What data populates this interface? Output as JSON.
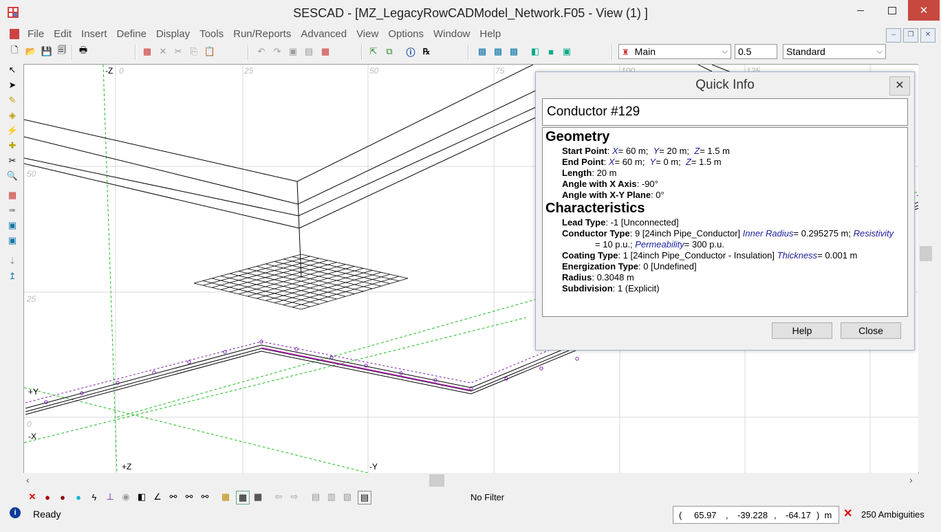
{
  "window": {
    "title": "SESCAD - [MZ_LegacyRowCADModel_Network.F05 - View (1) ]"
  },
  "menu": [
    "File",
    "Edit",
    "Insert",
    "Define",
    "Display",
    "Tools",
    "Run/Reports",
    "Advanced",
    "View",
    "Options",
    "Window",
    "Help"
  ],
  "toolbar": {
    "layer_value": "Main",
    "width_value": "0.5",
    "style_value": "Standard"
  },
  "canvas": {
    "axis_labels": {
      "neg_z_top": "-Z",
      "pos_y": "+Y",
      "neg_x": "-X",
      "pos_z": "+Z",
      "neg_y": "-Y"
    },
    "grid_labels": {
      "top_0": "0",
      "top_25": "25",
      "top_50": "50",
      "top_75": "75",
      "top_100": "100",
      "top_125": "125",
      "left_50": "50",
      "left_25": "25",
      "left_0": "0"
    }
  },
  "quick_info": {
    "title": "Quick Info",
    "close_glyph": "✕",
    "header": "Conductor #129",
    "geometry_heading": "Geometry",
    "start_point": {
      "label": "Start Point",
      "x": "60 m",
      "y": "20 m",
      "z": "1.5 m"
    },
    "end_point": {
      "label": "End Point",
      "x": "60 m",
      "y": "0 m",
      "z": "1.5 m"
    },
    "length": {
      "label": "Length",
      "value": "20 m"
    },
    "angle_x": {
      "label": "Angle with X Axis",
      "value": "-90°"
    },
    "angle_xy": {
      "label": "Angle with X-Y Plane",
      "value": "0°"
    },
    "characteristics_heading": "Characteristics",
    "lead_type": {
      "label": "Lead Type",
      "value": "-1 [Unconnected]"
    },
    "conductor_type": {
      "label": "Conductor Type",
      "value": "9 [24inch Pipe_Conductor]",
      "inner_radius_label": "Inner Radius",
      "inner_radius": "0.295275 m",
      "resistivity_label": "Resistivity",
      "resistivity": "10 p.u.",
      "permeability_label": "Permeability",
      "permeability": "300 p.u."
    },
    "coating_type": {
      "label": "Coating Type",
      "value": "1 [24inch Pipe_Conductor - Insulation]",
      "thickness_label": "Thickness",
      "thickness": "0.001 m"
    },
    "energization_type": {
      "label": "Energization Type",
      "value": "0 [Undefined]"
    },
    "radius": {
      "label": "Radius",
      "value": "0.3048 m"
    },
    "subdivision": {
      "label": "Subdivision",
      "value": "1 (Explicit)"
    },
    "help_button": "Help",
    "close_button": "Close"
  },
  "bottom_toolbar": {
    "filter_text": "No Filter"
  },
  "status": {
    "ready": "Ready",
    "open_paren": "(",
    "x": "65.97",
    "comma1": ",",
    "y": "-39.228",
    "comma2": ",",
    "z": "-64.17",
    "close_unit": ")  m",
    "ambiguities": "250 Ambiguities"
  },
  "colors": {
    "close_red": "#c7483f",
    "conductor_purple": "#7a1fb0",
    "axis_green": "#22bb22",
    "link_blue": "#1c1c9c"
  }
}
